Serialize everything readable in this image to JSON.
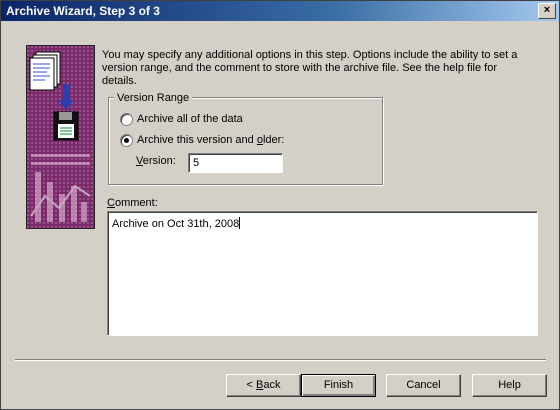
{
  "window": {
    "title": "Archive Wizard, Step 3 of 3",
    "close_glyph": "×"
  },
  "intro": {
    "text": "You may specify any additional options in this step.  Options include the ability to set a version range, and the comment to store with the archive file.  See the help file for details."
  },
  "version_range": {
    "legend": "Version Range",
    "option_all": "Archive all of the data",
    "option_version": {
      "pre": "Archive this version and ",
      "key": "o",
      "post": "lder:"
    },
    "selected": "version",
    "version_label": {
      "key": "V",
      "post": "ersion:"
    },
    "version_value": "5"
  },
  "comment": {
    "label_key": "C",
    "label_post": "omment:",
    "value": "Archive on Oct 31th, 2008"
  },
  "buttons": {
    "back": {
      "pre": "< ",
      "key": "B",
      "post": "ack"
    },
    "finish": "Finish",
    "cancel": "Cancel",
    "help": "Help"
  },
  "colors": {
    "art_primary": "#7b2a6b",
    "art_accent": "#2a3fb0"
  },
  "icons": [
    "wizard-illustration",
    "document-icon",
    "arrow-down-icon",
    "floppy-disk-icon",
    "close-icon"
  ]
}
